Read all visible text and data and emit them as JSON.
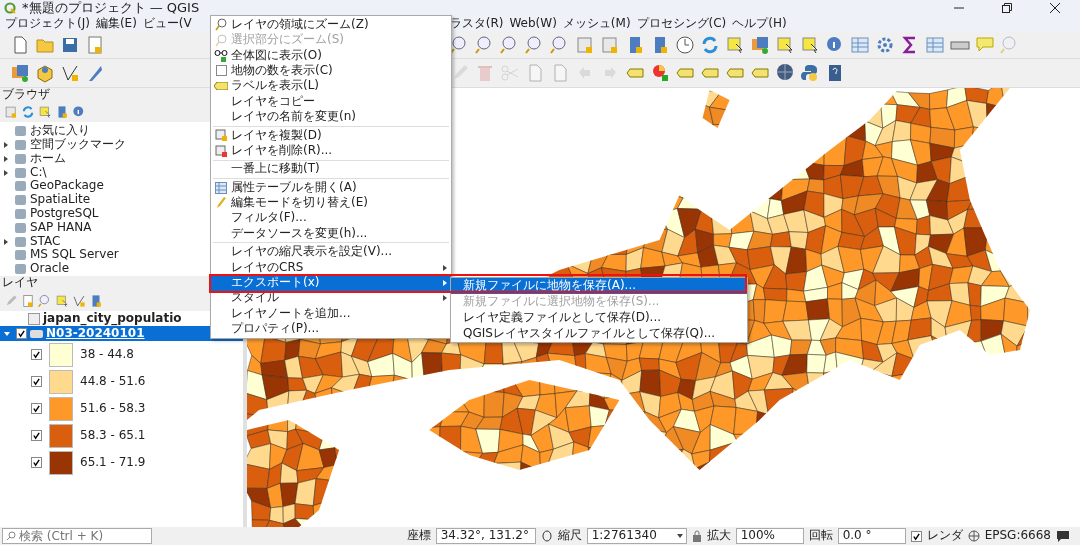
{
  "window": {
    "title": "*無題のプロジェクト — QGIS"
  },
  "menu_bar": [
    "プロジェクト(J)",
    "編集(E)",
    "ビュー(V",
    "ラスタ(R)",
    "Web(W)",
    "メッシュ(M)",
    "プロセシング(C)",
    "ヘルプ(H)"
  ],
  "browser_panel": {
    "title": "ブラウザ",
    "items": [
      {
        "label": "お気に入り",
        "expandable": false
      },
      {
        "label": "空間ブックマーク",
        "expandable": true
      },
      {
        "label": "ホーム",
        "expandable": true
      },
      {
        "label": "C:\\",
        "expandable": true
      },
      {
        "label": "GeoPackage",
        "expandable": false
      },
      {
        "label": "SpatiaLite",
        "expandable": false
      },
      {
        "label": "PostgreSQL",
        "expandable": false
      },
      {
        "label": "SAP HANA",
        "expandable": false
      },
      {
        "label": "STAC",
        "expandable": true
      },
      {
        "label": "MS SQL Server",
        "expandable": false
      },
      {
        "label": "Oracle",
        "expandable": false
      }
    ]
  },
  "layers_panel": {
    "title": "レイヤ",
    "layers": [
      {
        "name": "japan_city_populatio",
        "kind": "table",
        "selected": false
      },
      {
        "name": "N03-20240101",
        "kind": "vector",
        "selected": true,
        "checked": true,
        "expanded": true,
        "classes": [
          {
            "label": "38 - 44.8",
            "checked": true,
            "color": "#ffffd4"
          },
          {
            "label": "44.8 - 51.6",
            "checked": true,
            "color": "#fed98e"
          },
          {
            "label": "51.6 - 58.3",
            "checked": true,
            "color": "#fe9929"
          },
          {
            "label": "58.3 - 65.1",
            "checked": true,
            "color": "#d95f0e"
          },
          {
            "label": "65.1 - 71.9",
            "checked": true,
            "color": "#993404"
          }
        ]
      }
    ]
  },
  "context_menu": {
    "items": [
      {
        "label": "レイヤの領域にズーム(Z)",
        "kind": "zoom",
        "disabled": false,
        "submenu": false,
        "selected": false
      },
      {
        "label": "選択部分にズーム(S)",
        "kind": "zoom",
        "disabled": true,
        "submenu": false,
        "selected": false
      },
      {
        "label": "全体図に表示(O)",
        "kind": "overview",
        "disabled": false,
        "submenu": false,
        "selected": false
      },
      {
        "label": "地物の数を表示(C)",
        "kind": "check",
        "checked": false,
        "disabled": false,
        "submenu": false,
        "selected": false
      },
      {
        "label": "ラベルを表示(L)",
        "kind": "label",
        "disabled": false,
        "submenu": false,
        "selected": false
      },
      {
        "label": "レイヤをコピー",
        "kind": "plain",
        "disabled": false,
        "submenu": false,
        "selected": false
      },
      {
        "label": "レイヤの名前を変更(n)",
        "kind": "plain",
        "disabled": false,
        "submenu": false,
        "selected": false
      },
      {
        "kind": "separator"
      },
      {
        "label": "レイヤを複製(D)",
        "kind": "duplicate",
        "disabled": false,
        "submenu": false,
        "selected": false
      },
      {
        "label": "レイヤを削除(R)...",
        "kind": "remove",
        "disabled": false,
        "submenu": false,
        "selected": false
      },
      {
        "kind": "separator"
      },
      {
        "label": "一番上に移動(T)",
        "kind": "plain",
        "disabled": false,
        "submenu": false,
        "selected": false
      },
      {
        "kind": "separator"
      },
      {
        "label": "属性テーブルを開く(A)",
        "kind": "table",
        "disabled": false,
        "submenu": false,
        "selected": false
      },
      {
        "label": "編集モードを切り替え(E)",
        "kind": "pencil",
        "disabled": false,
        "submenu": false,
        "selected": false
      },
      {
        "label": "フィルタ(F)...",
        "kind": "plain",
        "disabled": false,
        "submenu": false,
        "selected": false
      },
      {
        "label": "データソースを変更(h)...",
        "kind": "plain",
        "disabled": false,
        "submenu": false,
        "selected": false
      },
      {
        "kind": "separator"
      },
      {
        "label": "レイヤの縮尺表示を設定(V)...",
        "kind": "plain",
        "disabled": false,
        "submenu": false,
        "selected": false
      },
      {
        "label": "レイヤのCRS",
        "kind": "plain",
        "disabled": false,
        "submenu": true,
        "selected": false
      },
      {
        "label": "エクスポート(x)",
        "kind": "plain",
        "disabled": false,
        "submenu": true,
        "selected": true
      },
      {
        "label": "スタイル",
        "kind": "plain",
        "disabled": false,
        "submenu": true,
        "selected": false
      },
      {
        "label": "レイヤノートを追加...",
        "kind": "plain",
        "disabled": false,
        "submenu": false,
        "selected": false
      },
      {
        "label": "プロパティ(P)...",
        "kind": "plain",
        "disabled": false,
        "submenu": false,
        "selected": false
      }
    ]
  },
  "export_submenu": {
    "items": [
      {
        "label": "新規ファイルに地物を保存(A)...",
        "disabled": false,
        "selected": true
      },
      {
        "label": "新規ファイルに選択地物を保存(S)...",
        "disabled": true,
        "selected": false
      },
      {
        "label": "レイヤ定義ファイルとして保存(D)...",
        "disabled": false,
        "selected": false
      },
      {
        "label": "QGISレイヤスタイルファイルとして保存(Q)...",
        "disabled": false,
        "selected": false
      }
    ]
  },
  "status_bar": {
    "search_placeholder": "検索 (Ctrl + K)",
    "coordinate_label": "座標",
    "coordinate": "34.32°, 131.2°",
    "scale_label": "縮尺",
    "scale": "1:2761340",
    "magnifier_label": "拡大",
    "magnifier": "100%",
    "rotation_label": "回転",
    "rotation": "0.0 °",
    "render_label": "レンダ",
    "render_checked": true,
    "crs": "EPSG:6668"
  }
}
